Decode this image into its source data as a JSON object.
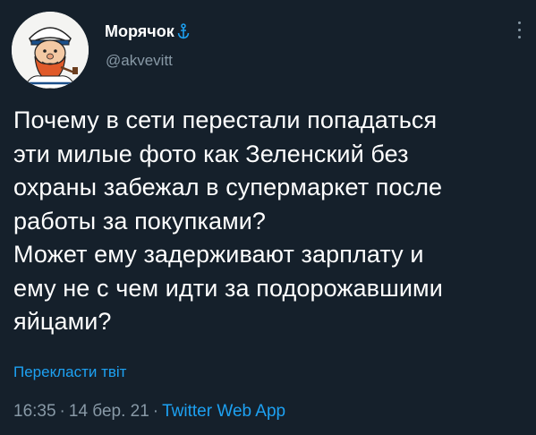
{
  "author": {
    "display_name": "Морячок",
    "handle": "@akvevitt",
    "avatar_icon": "sailor-avatar",
    "badge_icon": "anchor-icon"
  },
  "tweet": {
    "lines": [
      "Почему в сети перестали попадаться",
      "эти милые фото как Зеленский без",
      "охраны забежал в супермаркет после",
      "работы за покупками?",
      "Может ему задерживают зарплату и",
      "ему не с чем идти за подорожавшими",
      "яйцами?"
    ],
    "translate_label": "Перекласти твіт",
    "time": "16:35",
    "date": "14 бер. 21",
    "source": "Twitter Web App",
    "separator": "·"
  },
  "colors": {
    "background": "#15202b",
    "text": "#ffffff",
    "secondary": "#8899a6",
    "accent": "#1da1f2"
  }
}
